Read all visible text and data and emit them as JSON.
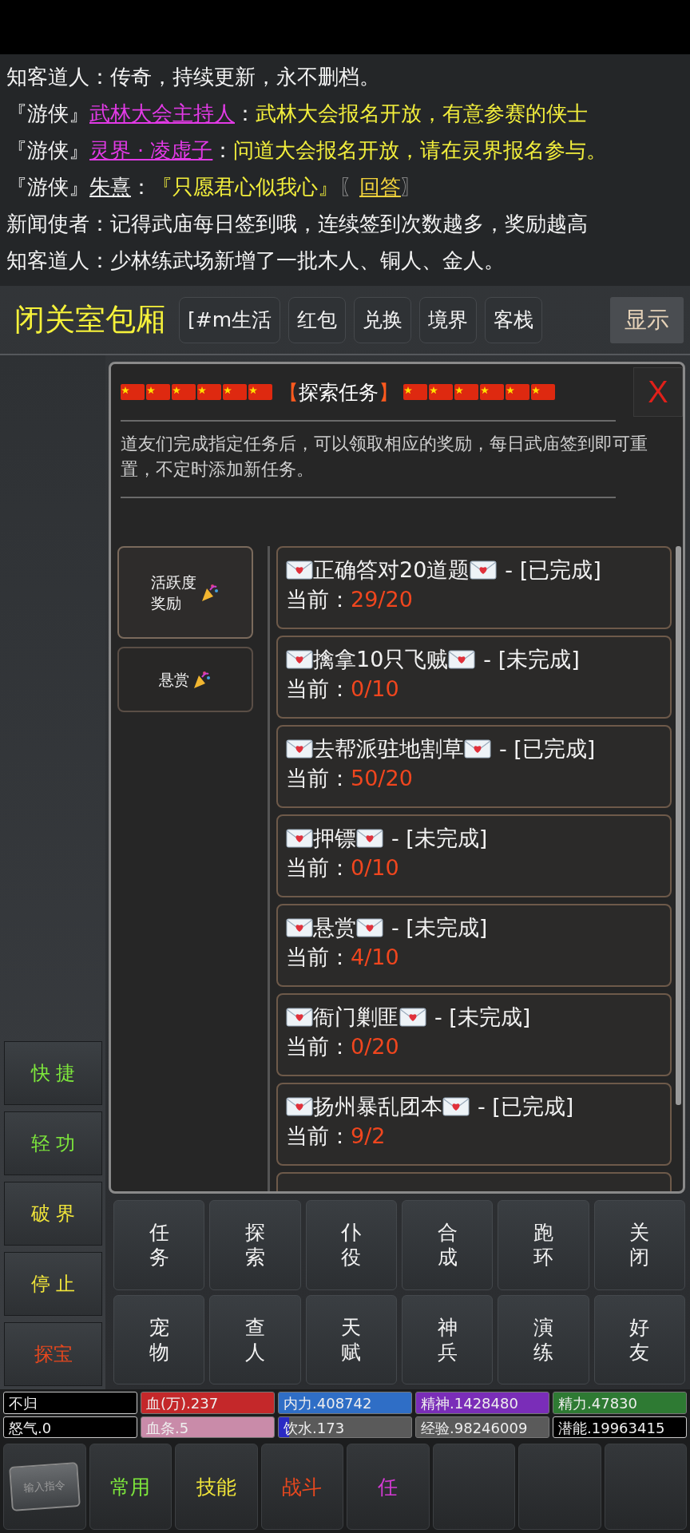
{
  "chat": [
    {
      "segments": [
        {
          "kind": "plain",
          "text": "知客道人：传奇，持续更新，永不删档。"
        }
      ]
    },
    {
      "segments": [
        {
          "kind": "plain",
          "text": "『游侠』"
        },
        {
          "kind": "user",
          "text": "武林大会主持人"
        },
        {
          "kind": "plain",
          "text": "："
        },
        {
          "kind": "message",
          "text": "武林大会报名开放，有意参赛的侠士"
        }
      ]
    },
    {
      "segments": [
        {
          "kind": "plain",
          "text": "『游侠』"
        },
        {
          "kind": "user",
          "text": "灵界 · 凌虚子"
        },
        {
          "kind": "plain",
          "text": "："
        },
        {
          "kind": "message",
          "text": "问道大会报名开放，请在灵界报名参与。"
        }
      ]
    },
    {
      "segments": [
        {
          "kind": "plain",
          "text": "『游侠』"
        },
        {
          "kind": "name",
          "text": "朱熹"
        },
        {
          "kind": "plain",
          "text": "："
        },
        {
          "kind": "message",
          "text": "『只愿君心似我心』"
        },
        {
          "kind": "bracket",
          "text": "〖"
        },
        {
          "kind": "link",
          "text": "回答"
        },
        {
          "kind": "bracket",
          "text": "〗"
        }
      ]
    },
    {
      "segments": [
        {
          "kind": "plain",
          "text": "新闻使者：记得武庙每日签到哦，连续签到次数越多，奖励越高"
        }
      ]
    },
    {
      "segments": [
        {
          "kind": "plain",
          "text": "知客道人：少林练武场新增了一批木人、铜人、金人。"
        }
      ]
    }
  ],
  "room": {
    "title": "闭关室包厢",
    "buttons": [
      "[#m生活",
      "红包",
      "兑换",
      "境界",
      "客栈"
    ],
    "show_button": "显示"
  },
  "panel": {
    "title": {
      "open": "【",
      "text": "探索任务",
      "close": "】"
    },
    "close": "X",
    "description": "道友们完成指定任务后，可以领取相应的奖励，每日武庙签到即可重置，不定时添加新任务。",
    "categories": [
      {
        "label": "活跃度奖励",
        "selected": true
      },
      {
        "label": "悬赏",
        "selected": false
      }
    ],
    "tasks": [
      {
        "name": "正确答对20道题",
        "status": "- [已完成]",
        "current_label": "当前：",
        "progress": "29/20"
      },
      {
        "name": "擒拿10只飞贼",
        "status": "- [未完成]",
        "current_label": "当前：",
        "progress": "0/10"
      },
      {
        "name": "去帮派驻地割草",
        "status": "- [已完成]",
        "current_label": "当前：",
        "progress": "50/20"
      },
      {
        "name": "押镖",
        "status": "- [未完成]",
        "current_label": "当前：",
        "progress": "0/10"
      },
      {
        "name": "悬赏",
        "status": "- [未完成]",
        "current_label": "当前：",
        "progress": "4/10"
      },
      {
        "name": "衙门剿匪",
        "status": "- [未完成]",
        "current_label": "当前：",
        "progress": "0/20"
      },
      {
        "name": "扬州暴乱团本",
        "status": "- [已完成]",
        "current_label": "当前：",
        "progress": "9/2"
      }
    ]
  },
  "side_buttons": [
    {
      "label": "快 捷",
      "color": "#7ee83c"
    },
    {
      "label": "轻 功",
      "color": "#7ee83c"
    },
    {
      "label": "破 界",
      "color": "#f2e63a"
    },
    {
      "label": "停 止",
      "color": "#f2e63a"
    },
    {
      "label": "探宝",
      "color": "#e8481e"
    }
  ],
  "actions": [
    "任务",
    "探索",
    "仆役",
    "合成",
    "跑环",
    "关闭",
    "宠物",
    "查人",
    "天赋",
    "神兵",
    "演练",
    "好友"
  ],
  "stats": [
    {
      "text": "不归",
      "color": "#000000"
    },
    {
      "text": "血(万).237",
      "color": "#c4282a",
      "level": 1
    },
    {
      "text": "内力.408742",
      "color": "#2f6ec6",
      "level": 1
    },
    {
      "text": "精神.1428480",
      "color": "#7a2db8",
      "level": 1
    },
    {
      "text": "精力.47830",
      "color": "#2e7a33",
      "level": 1
    },
    {
      "text": "怒气.0",
      "color": "#000000"
    },
    {
      "text": "血条.5",
      "color": "#c98ba9",
      "level": 1
    },
    {
      "text": "饮水.173",
      "color": "#2a2ac4",
      "level": 0.08
    },
    {
      "text": "经验.98246009",
      "color": "#5a5a5a",
      "level": 1
    },
    {
      "text": "潜能.19963415",
      "color": "#000000"
    }
  ],
  "bottom_tabs": [
    {
      "kind": "input",
      "text": "输入指令"
    },
    {
      "kind": "tab",
      "text": "常用",
      "color": "#7ee83c"
    },
    {
      "kind": "tab",
      "text": "技能",
      "color": "#f2e63a"
    },
    {
      "kind": "tab",
      "text": "战斗",
      "color": "#e8481e"
    },
    {
      "kind": "tab",
      "text": "任",
      "color": "#d43ad4"
    },
    {
      "kind": "tab"
    },
    {
      "kind": "tab"
    },
    {
      "kind": "tab"
    }
  ]
}
